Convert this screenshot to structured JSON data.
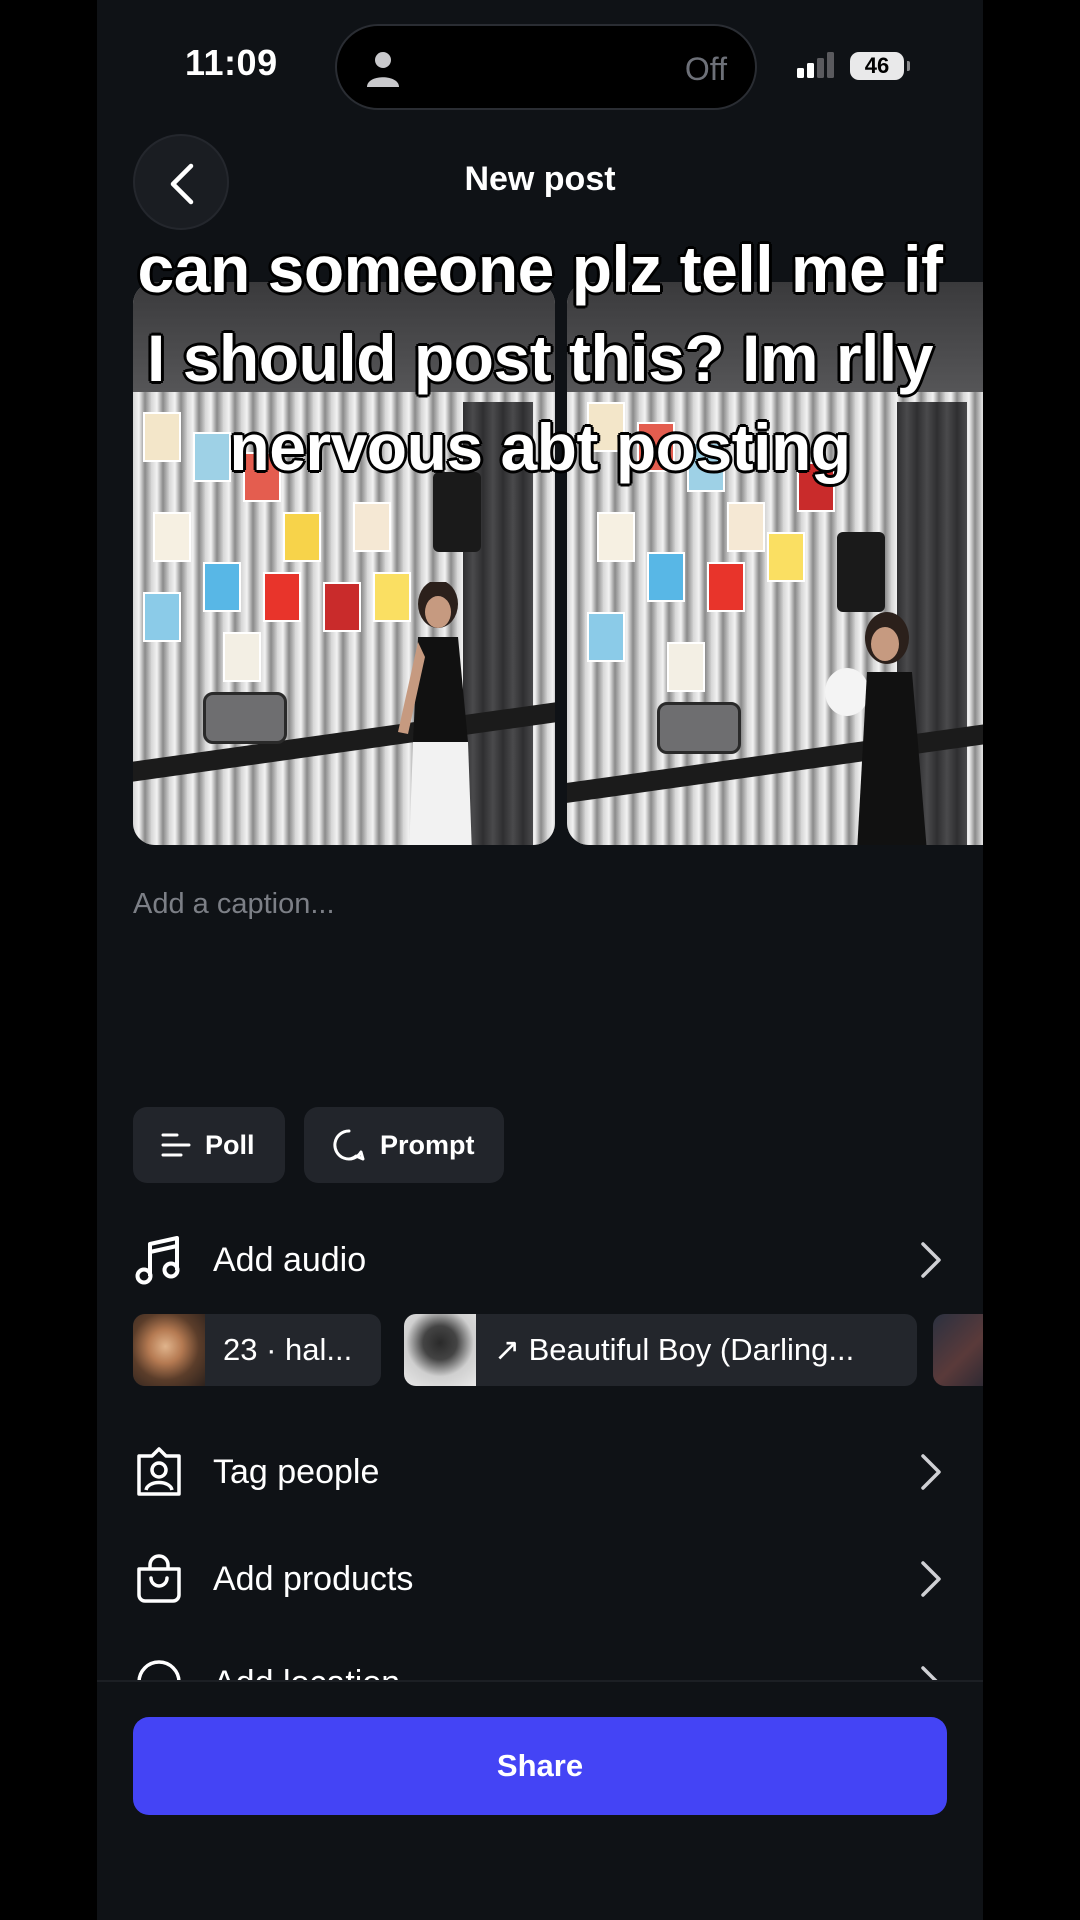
{
  "status_bar": {
    "time": "11:09",
    "focus_status": "Off",
    "battery": "46"
  },
  "header": {
    "title": "New post"
  },
  "overlay": {
    "lines": [
      "can someone plz tell me if",
      "I should post this? Im rlly",
      "nervous abt posting"
    ]
  },
  "caption": {
    "placeholder": "Add a caption..."
  },
  "chips": {
    "poll": "Poll",
    "prompt": "Prompt"
  },
  "rows": {
    "add_audio": "Add audio",
    "tag_people": "Tag people",
    "add_products": "Add products",
    "add_location": "Add location"
  },
  "audio_suggestions": [
    {
      "label": "23 · hal..."
    },
    {
      "label": "↗ Beautiful Boy (Darling..."
    }
  ],
  "share": {
    "label": "Share"
  },
  "colors": {
    "background": "#0f1216",
    "share_button": "#4444f5",
    "placeholder": "#7c7f86"
  },
  "icons": [
    "back-arrow-icon",
    "person-icon",
    "signal-icon",
    "poll-icon",
    "prompt-icon",
    "music-note-icon",
    "chevron-right-icon",
    "tag-person-icon",
    "shopping-bag-icon",
    "location-icon"
  ]
}
